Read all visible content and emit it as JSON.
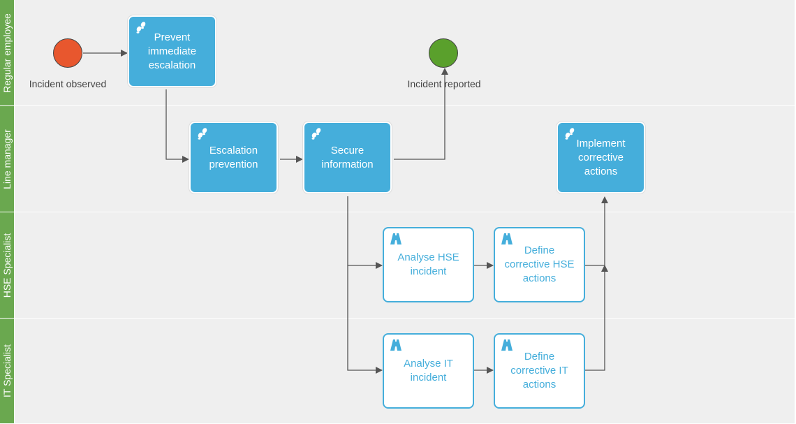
{
  "lanes": [
    "Regular employee",
    "Line manager",
    "HSE Specialist",
    "IT Specialist"
  ],
  "events": {
    "start": {
      "label": "Incident observed",
      "color": "#e8572e"
    },
    "end": {
      "label": "Incident reported",
      "color": "#5aa02c"
    }
  },
  "tasks": [
    {
      "label": "Prevent immediate escalation",
      "type": "user",
      "icon": "footsteps-icon"
    },
    {
      "label": "Escalation prevention",
      "type": "user",
      "icon": "footsteps-icon"
    },
    {
      "label": "Secure information",
      "type": "user",
      "icon": "footsteps-icon"
    },
    {
      "label": "Implement corrective actions",
      "type": "user",
      "icon": "footsteps-icon"
    },
    {
      "label": "Analyse HSE incident",
      "type": "subprocess",
      "icon": "road-icon"
    },
    {
      "label": "Define corrective HSE actions",
      "type": "subprocess",
      "icon": "road-icon"
    },
    {
      "label": "Analyse IT incident",
      "type": "subprocess",
      "icon": "road-icon"
    },
    {
      "label": "Define corrective IT actions",
      "type": "subprocess",
      "icon": "road-icon"
    }
  ],
  "colors": {
    "lane_header": "#6aa84f",
    "task_fill": "#45aedb"
  }
}
